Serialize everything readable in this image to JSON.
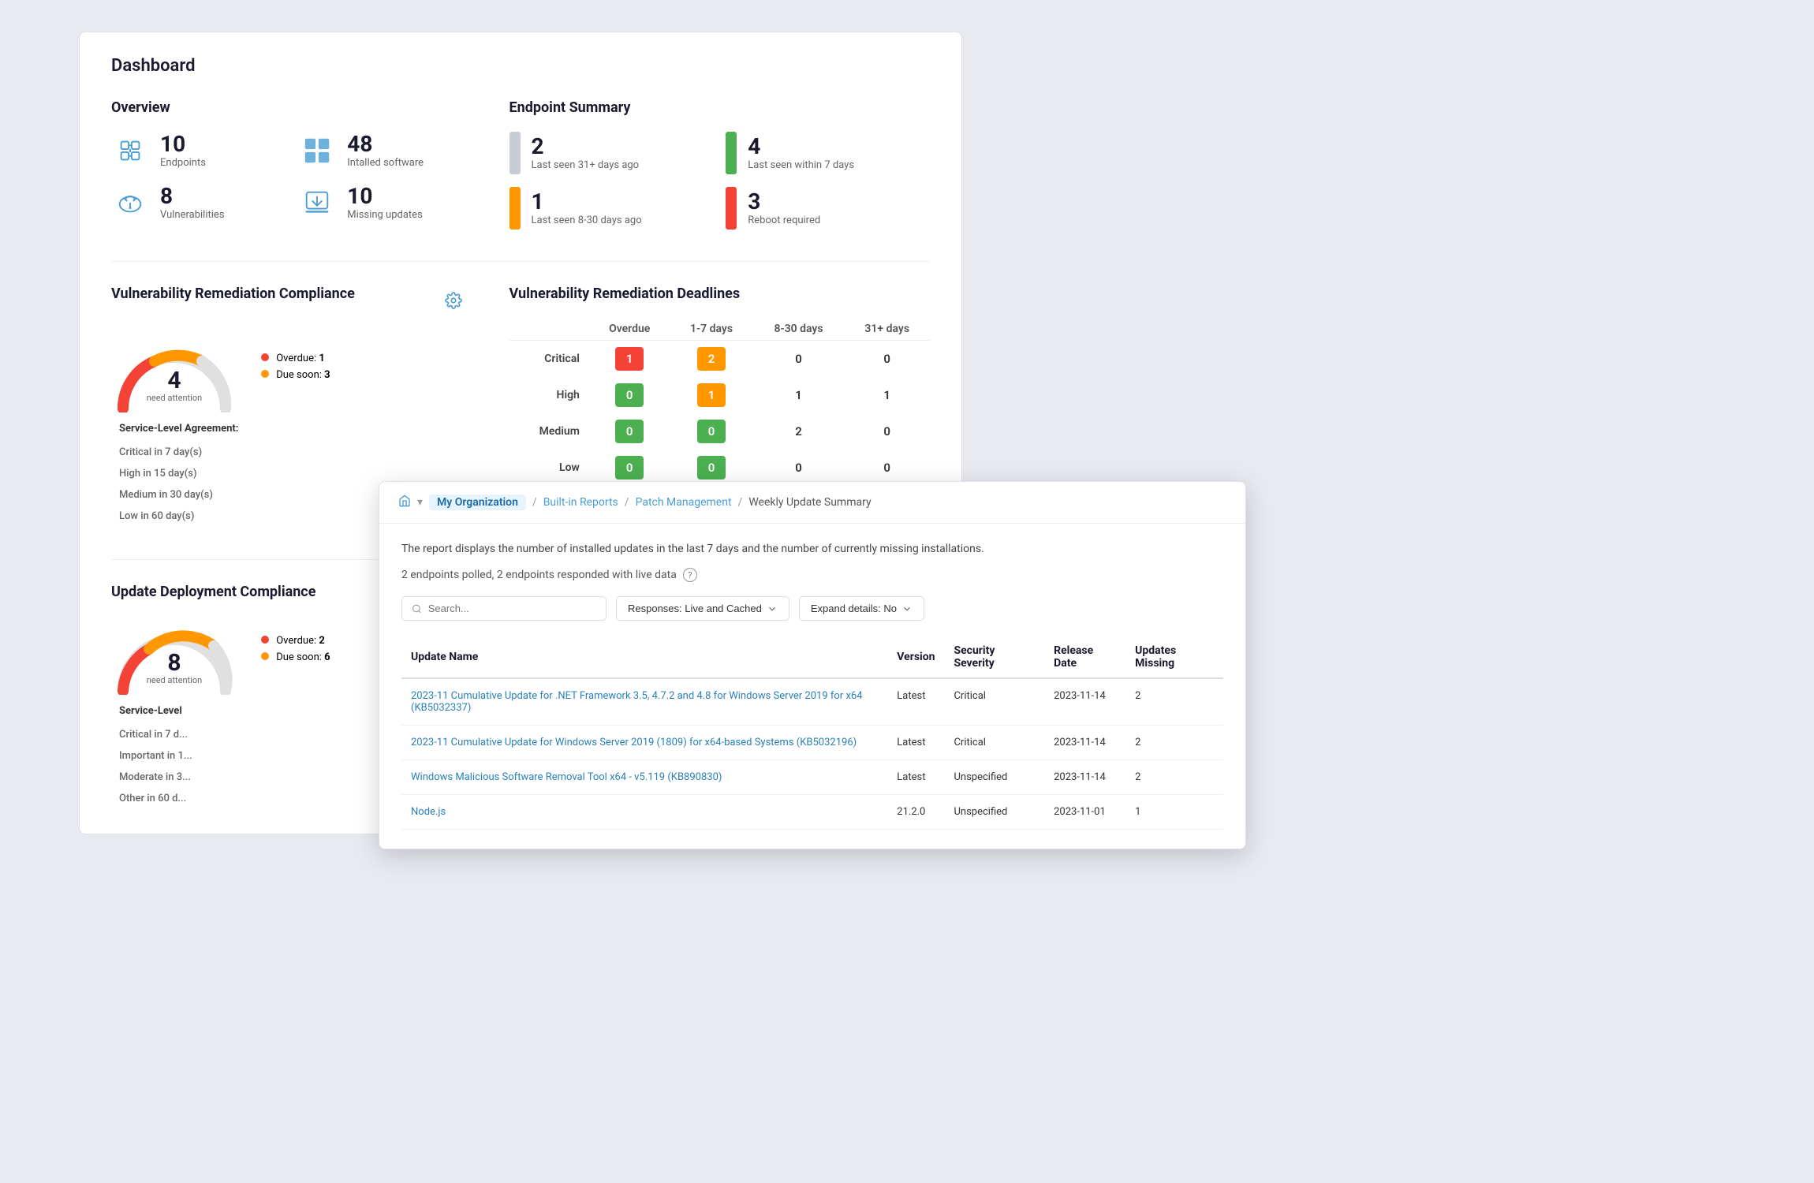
{
  "dashboard": {
    "title": "Dashboard",
    "overview": {
      "title": "Overview",
      "items": [
        {
          "count": "10",
          "label": "Endpoints",
          "icon": "endpoints"
        },
        {
          "count": "48",
          "label": "Intalled software",
          "icon": "software"
        },
        {
          "count": "8",
          "label": "Vulnerabilities",
          "icon": "vulnerabilities"
        },
        {
          "count": "10",
          "label": "Missing updates",
          "icon": "updates"
        }
      ]
    },
    "endpoint_summary": {
      "title": "Endpoint Summary",
      "items": [
        {
          "count": "2",
          "label": "Last seen 31+ days ago",
          "color": "gray"
        },
        {
          "count": "4",
          "label": "Last seen within 7 days",
          "color": "green"
        },
        {
          "count": "1",
          "label": "Last seen 8-30 days ago",
          "color": "orange"
        },
        {
          "count": "3",
          "label": "Reboot required",
          "color": "red"
        }
      ]
    },
    "vrc": {
      "title": "Vulnerability Remediation Compliance",
      "gauge_num": "4",
      "gauge_label": "need attention",
      "overdue_label": "Overdue:",
      "overdue_val": "1",
      "duesoon_label": "Due soon:",
      "duesoon_val": "3",
      "sla_header": "Service-Level Agreement:",
      "sla_rows": [
        {
          "level": "Critical in 7 day(s)"
        },
        {
          "level": "High in 15 day(s)"
        },
        {
          "level": "Medium in 30 day(s)"
        },
        {
          "level": "Low in 60 day(s)"
        }
      ]
    },
    "vrd": {
      "title": "Vulnerability Remediation Deadlines",
      "col_headers": [
        "",
        "Overdue",
        "1-7 days",
        "8-30 days",
        "31+ days"
      ],
      "rows": [
        {
          "label": "Critical",
          "overdue": "1",
          "overdue_style": "red",
          "d1_7": "2",
          "d1_7_style": "orange",
          "d8_30": "0",
          "d31plus": "0"
        },
        {
          "label": "High",
          "overdue": "0",
          "overdue_style": "green",
          "d1_7": "1",
          "d1_7_style": "orange",
          "d8_30": "1",
          "d31plus": "1"
        },
        {
          "label": "Medium",
          "overdue": "0",
          "overdue_style": "green",
          "d1_7": "0",
          "d1_7_style": "green",
          "d8_30": "2",
          "d31plus": "0"
        },
        {
          "label": "Low",
          "overdue": "0",
          "overdue_style": "green",
          "d1_7": "0",
          "d1_7_style": "green",
          "d8_30": "0",
          "d31plus": "0"
        }
      ]
    },
    "udc": {
      "title": "Update Deployment Compliance",
      "gauge_num": "8",
      "gauge_label": "need attention",
      "overdue_label": "Overdue:",
      "overdue_val": "2",
      "duesoon_label": "Due soon:",
      "duesoon_val": "6",
      "sla_header": "Service-Level",
      "sla_rows": [
        {
          "level": "Critical in 7 d..."
        },
        {
          "level": "Important in 1..."
        },
        {
          "level": "Moderate in 3..."
        },
        {
          "level": "Other in 60 d..."
        }
      ]
    }
  },
  "report": {
    "breadcrumb": {
      "home_icon": "home",
      "org_label": "My Organization",
      "sep1": "/",
      "reports_label": "Built-in Reports",
      "sep2": "/",
      "patch_label": "Patch Management",
      "sep3": "/",
      "current_label": "Weekly Update Summary"
    },
    "description": "The report displays the number of installed updates in the last 7 days and the number of currently missing installations.",
    "meta": "2 endpoints polled, 2 endpoints responded with live data",
    "search_placeholder": "Search...",
    "filter_responses": "Responses: Live and Cached",
    "filter_expand": "Expand details: No",
    "table": {
      "headers": [
        "Update Name",
        "Version",
        "Security Severity",
        "Release Date",
        "Updates Missing"
      ],
      "rows": [
        {
          "name": "2023-11 Cumulative Update for .NET Framework 3.5, 4.7.2 and 4.8 for Windows Server 2019 for x64 (KB5032337)",
          "version": "Latest",
          "severity": "Critical",
          "release_date": "2023-11-14",
          "missing": "2"
        },
        {
          "name": "2023-11 Cumulative Update for Windows Server 2019 (1809) for x64-based Systems (KB5032196)",
          "version": "Latest",
          "severity": "Critical",
          "release_date": "2023-11-14",
          "missing": "2"
        },
        {
          "name": "Windows Malicious Software Removal Tool x64 - v5.119 (KB890830)",
          "version": "Latest",
          "severity": "Unspecified",
          "release_date": "2023-11-14",
          "missing": "2"
        },
        {
          "name": "Node.js",
          "version": "21.2.0",
          "severity": "Unspecified",
          "release_date": "2023-11-01",
          "missing": "1"
        }
      ]
    }
  }
}
